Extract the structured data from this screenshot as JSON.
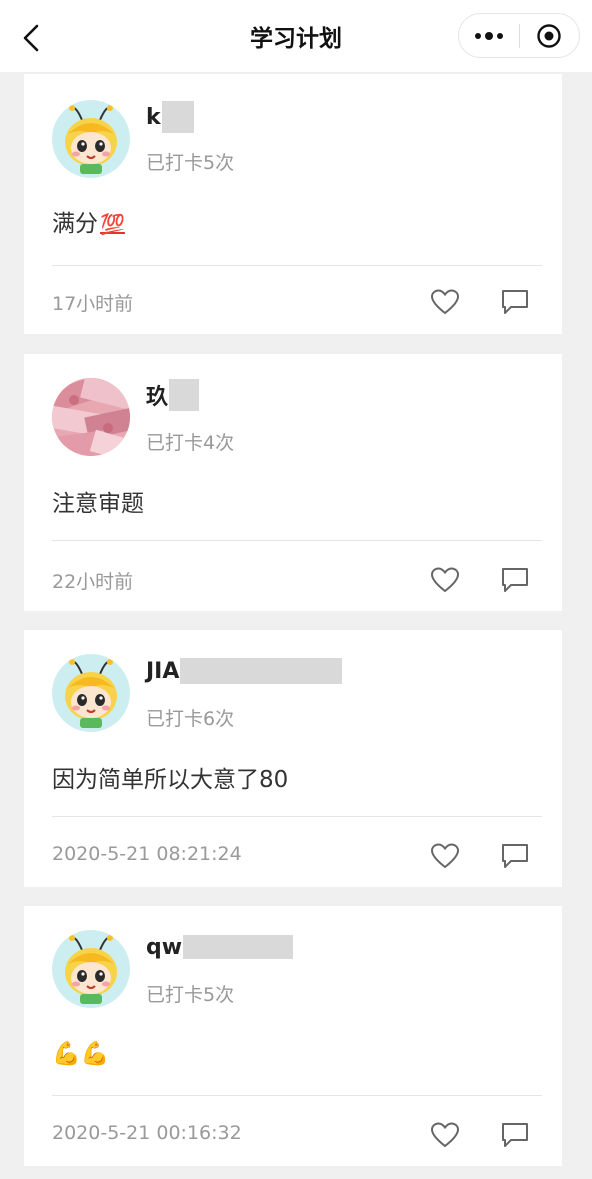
{
  "nav": {
    "title": "学习计划",
    "back_icon": "chevron-left-icon",
    "more_icon": "more-dots-icon",
    "close_icon": "target-close-icon"
  },
  "posts": [
    {
      "username": "k",
      "checkin": "已打卡5次",
      "content": "满分",
      "content_emoji": "💯",
      "time": "17小时前",
      "avatar": "bee-cartoon-avatar"
    },
    {
      "username": "玖",
      "checkin": "已打卡4次",
      "content": "注意审题",
      "time": "22小时前",
      "avatar": "money-photo-avatar"
    },
    {
      "username": "JIA",
      "checkin": "已打卡6次",
      "content": "因为简单所以大意了80",
      "time": "2020-5-21 08:21:24",
      "avatar": "bee-cartoon-avatar"
    },
    {
      "username": "qw",
      "checkin": "已打卡5次",
      "content": "💪💪",
      "time": "2020-5-21 00:16:32",
      "avatar": "bee-cartoon-avatar"
    }
  ],
  "colors": {
    "background": "#f0f0f0",
    "card": "#ffffff",
    "muted_text": "#999999",
    "primary_text": "#333333"
  }
}
